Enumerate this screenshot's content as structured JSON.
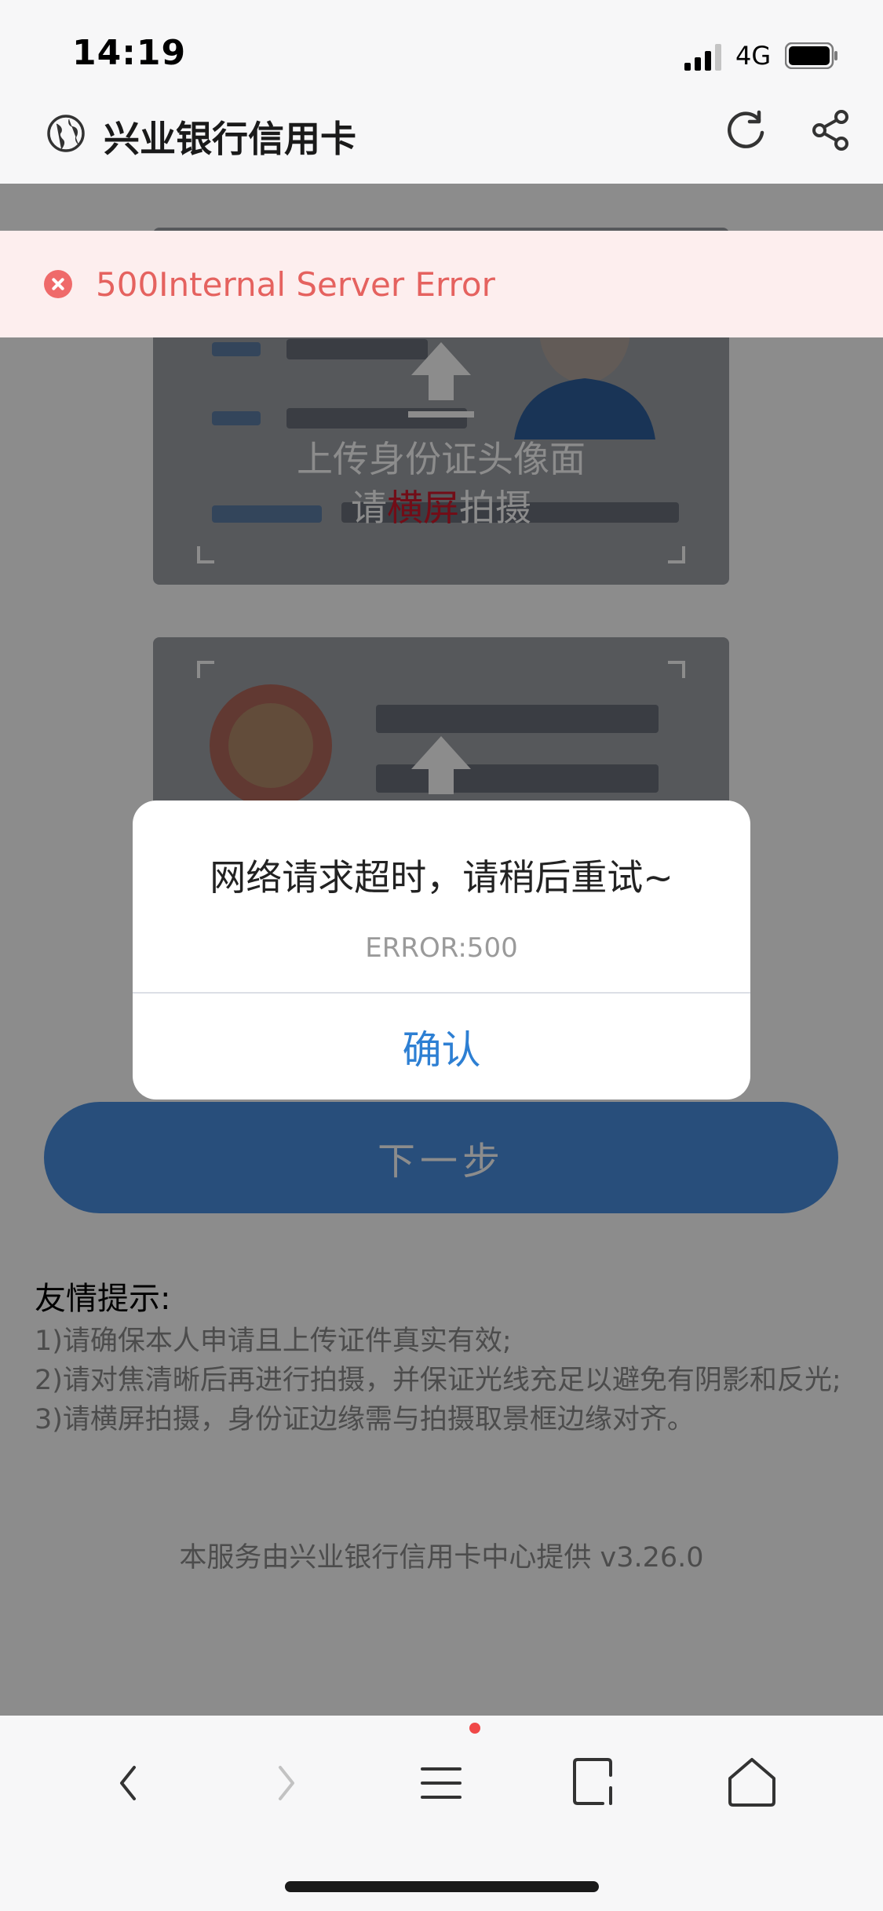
{
  "status_bar": {
    "time": "14:19",
    "network": "4G"
  },
  "nav": {
    "title": "兴业银行信用卡",
    "icons": [
      "globe-icon",
      "refresh-icon",
      "share-icon"
    ]
  },
  "error_toast": {
    "text": "500Internal Server Error",
    "icon": "error-circle-icon",
    "color": "#e5625f"
  },
  "upload": {
    "front_caption_line1": "上传身份证头像面",
    "front_caption_line2_pre": "请",
    "front_caption_line2_highlight": "横屏",
    "front_caption_line2_post": "拍摄",
    "highlight_color": "#d0192b"
  },
  "dialog": {
    "title": "网络请求超时，请稍后重试~",
    "code": "ERROR:500",
    "confirm_label": "确认",
    "confirm_color": "#2d7fd3"
  },
  "next_button": {
    "label": "下一步",
    "color": "#4a8fe0"
  },
  "tips": {
    "title": "友情提示:",
    "items": [
      "1)请确保本人申请且上传证件真实有效;",
      "2)请对焦清晰后再进行拍摄，并保证光线充足以避免有阴影和反光;",
      "3)请横屏拍摄，身份证边缘需与拍摄取景框边缘对齐。"
    ]
  },
  "footer": {
    "note": "本服务由兴业银行信用卡中心提供 v3.26.0"
  },
  "toolbar": {
    "icons": [
      "back-icon",
      "forward-icon",
      "menu-icon",
      "tabs-icon",
      "home-icon"
    ],
    "menu_has_badge": true
  }
}
